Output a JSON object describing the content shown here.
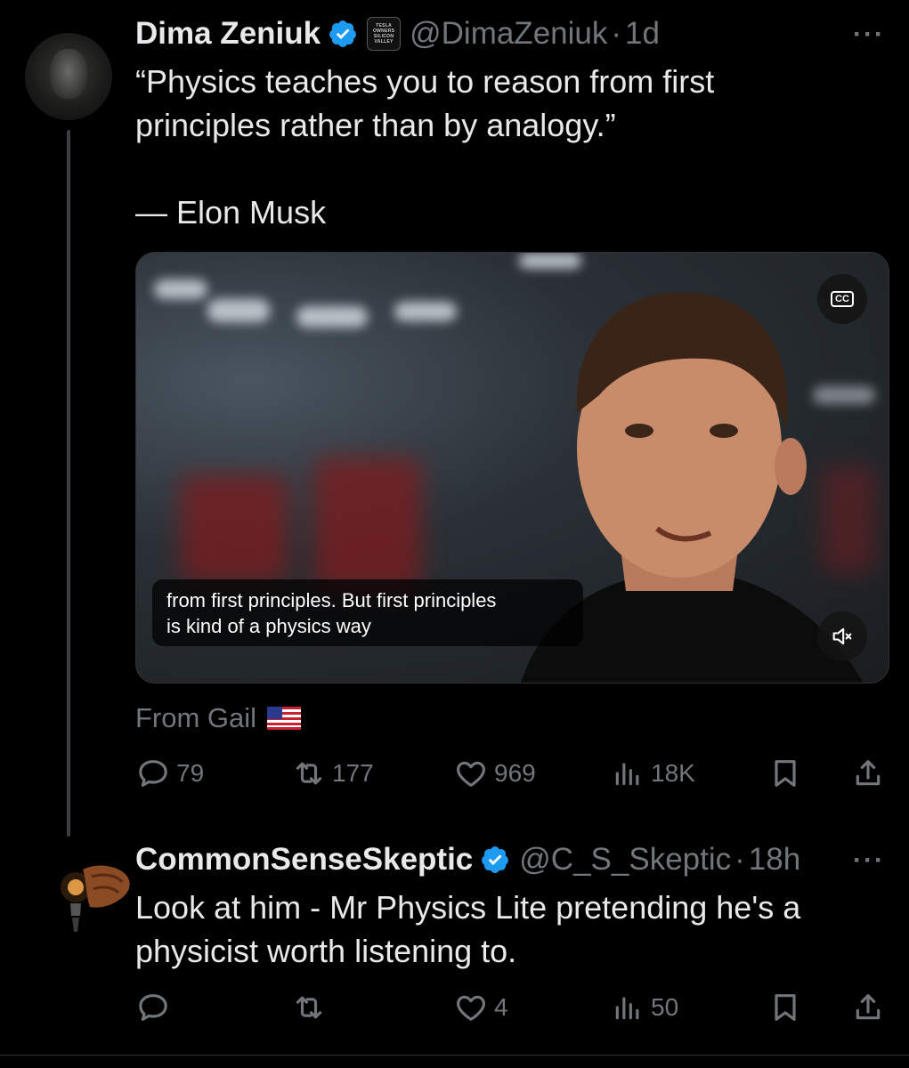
{
  "tweet1": {
    "name": "Dima Zeniuk",
    "badge_text": [
      "TESLA",
      "OWNERS",
      "SILICON",
      "VALLEY"
    ],
    "handle": "@DimaZeniuk",
    "dot": "·",
    "time": "1d",
    "more": "···",
    "text": "“Physics teaches you to reason from first\nprinciples rather than by analogy.”\n\n— Elon Musk",
    "video": {
      "cc_label": "CC",
      "caption": "from first principles. But first principles\nis kind of a physics way"
    },
    "source_label": "From Gail",
    "replies": "79",
    "reposts": "177",
    "likes": "969",
    "views": "18K"
  },
  "tweet2": {
    "name": "CommonSenseSkeptic",
    "handle": "@C_S_Skeptic",
    "dot": "·",
    "time": "18h",
    "more": "···",
    "text": "Look at him - Mr Physics Lite pretending he's a\nphysicist worth listening to.",
    "likes": "4",
    "views": "50"
  },
  "colors": {
    "background": "#000000",
    "text": "#e7e9ea",
    "secondary": "#71767b",
    "verified": "#1d9bf0",
    "thread_line": "#3a3d41"
  }
}
